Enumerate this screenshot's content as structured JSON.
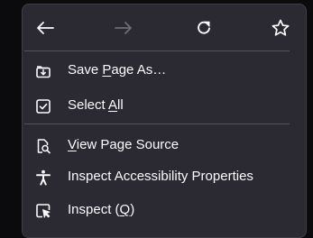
{
  "nav": {
    "back_icon": "arrow-left-icon",
    "forward_icon": "arrow-right-icon",
    "reload_icon": "reload-icon",
    "bookmark_icon": "star-icon",
    "forward_disabled": true
  },
  "items": [
    {
      "label_pre": "Save ",
      "label_key": "P",
      "label_post": "age As…",
      "icon": "save-page-icon"
    },
    {
      "label_pre": "Select ",
      "label_key": "A",
      "label_post": "ll",
      "icon": "select-all-icon"
    },
    {
      "label_pre": "",
      "label_key": "V",
      "label_post": "iew Page Source",
      "icon": "view-source-icon"
    },
    {
      "label_pre": "Inspect Accessibility Properties",
      "label_key": "",
      "label_post": "",
      "icon": "accessibility-icon"
    },
    {
      "label_pre": "Inspect (",
      "label_key": "Q",
      "label_post": ")",
      "icon": "inspect-icon"
    }
  ],
  "colors": {
    "menu_bg": "#2b2a33",
    "text": "#fbfbfe",
    "disabled": "#8f8f9d",
    "separator": "#55545c"
  }
}
